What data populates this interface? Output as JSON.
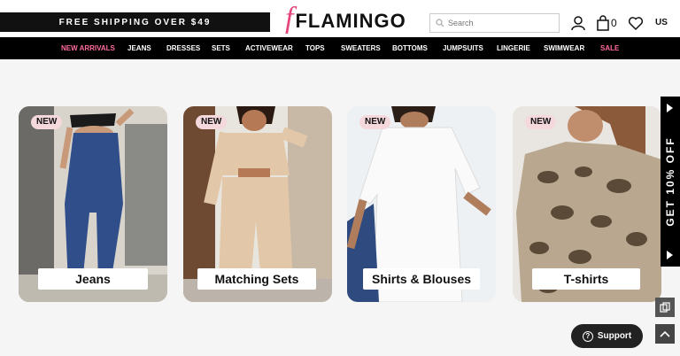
{
  "header": {
    "promo": "FREE SHIPPING OVER $49",
    "logo_mark": "f",
    "logo_text": "FLAMINGO",
    "search_placeholder": "Search",
    "cart_count": "0",
    "region": "US"
  },
  "nav": {
    "items": [
      {
        "label": "NEW ARRIVALS",
        "accent": true
      },
      {
        "label": "JEANS"
      },
      {
        "label": "DRESSES"
      },
      {
        "label": "SETS"
      },
      {
        "label": "ACTIVEWEAR"
      },
      {
        "label": "TOPS"
      },
      {
        "label": "SWEATERS"
      },
      {
        "label": "BOTTOMS"
      },
      {
        "label": "JUMPSUITS"
      },
      {
        "label": "LINGERIE"
      },
      {
        "label": "SWIMWEAR"
      },
      {
        "label": "SALE",
        "accent": true
      }
    ]
  },
  "categories": [
    {
      "badge": "NEW",
      "caption": "Jeans"
    },
    {
      "badge": "NEW",
      "caption": "Matching Sets"
    },
    {
      "badge": "NEW",
      "caption": "Shirts & Blouses"
    },
    {
      "badge": "NEW",
      "caption": "T-shirts"
    }
  ],
  "side_tab": {
    "label": "GET 10% OFF"
  },
  "support": {
    "label": "Support"
  },
  "colors": {
    "accent": "#e5457a",
    "nav_bg": "#000000",
    "badge_bg": "#f4d8dc"
  },
  "icons": [
    "search-icon",
    "user-icon",
    "bag-icon",
    "heart-icon",
    "copy-icon",
    "chevron-up-icon",
    "help-icon"
  ]
}
